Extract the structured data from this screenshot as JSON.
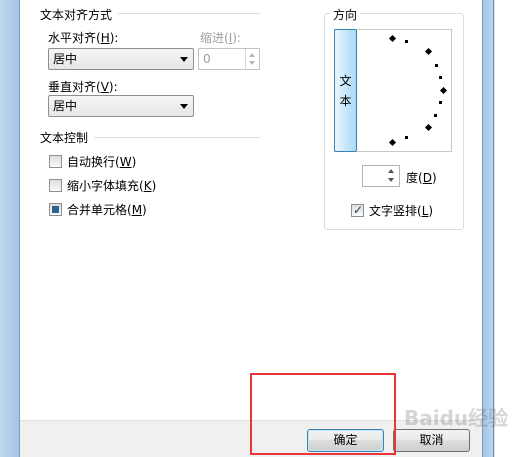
{
  "text_alignment": {
    "section_title": "文本对齐方式",
    "horizontal_label_prefix": "水平对齐(",
    "horizontal_label_key": "H",
    "horizontal_label_suffix": "):",
    "horizontal_value": "居中",
    "indent_label_prefix": "缩进(",
    "indent_label_key": "I",
    "indent_label_suffix": "):",
    "indent_value": "0",
    "vertical_label_prefix": "垂直对齐(",
    "vertical_label_key": "V",
    "vertical_label_suffix": "):",
    "vertical_value": "居中"
  },
  "text_control": {
    "section_title": "文本控制",
    "wrap": {
      "prefix": "自动换行(",
      "key": "W",
      "suffix": ")",
      "checked": false
    },
    "shrink": {
      "prefix": "缩小字体填充(",
      "key": "K",
      "suffix": ")",
      "checked": false
    },
    "merge": {
      "prefix": "合并单元格(",
      "key": "M",
      "suffix": ")",
      "checked": "indeterminate"
    }
  },
  "orientation": {
    "section_title": "方向",
    "vertical_text_char1": "文",
    "vertical_text_char2": "本",
    "degree_value": "",
    "degree_label_prefix": "度(",
    "degree_label_key": "D",
    "degree_label_suffix": ")",
    "vertical_checkbox": {
      "prefix": "文字竖排(",
      "key": "L",
      "suffix": ")",
      "checked": true
    }
  },
  "footer": {
    "ok_label": "确定",
    "cancel_label": "取消"
  },
  "watermark_text": "Baidu经验",
  "colors": {
    "highlight": "#e8373b",
    "frame": "#a4c4e6",
    "accent_blue": "#3c7fb1"
  }
}
